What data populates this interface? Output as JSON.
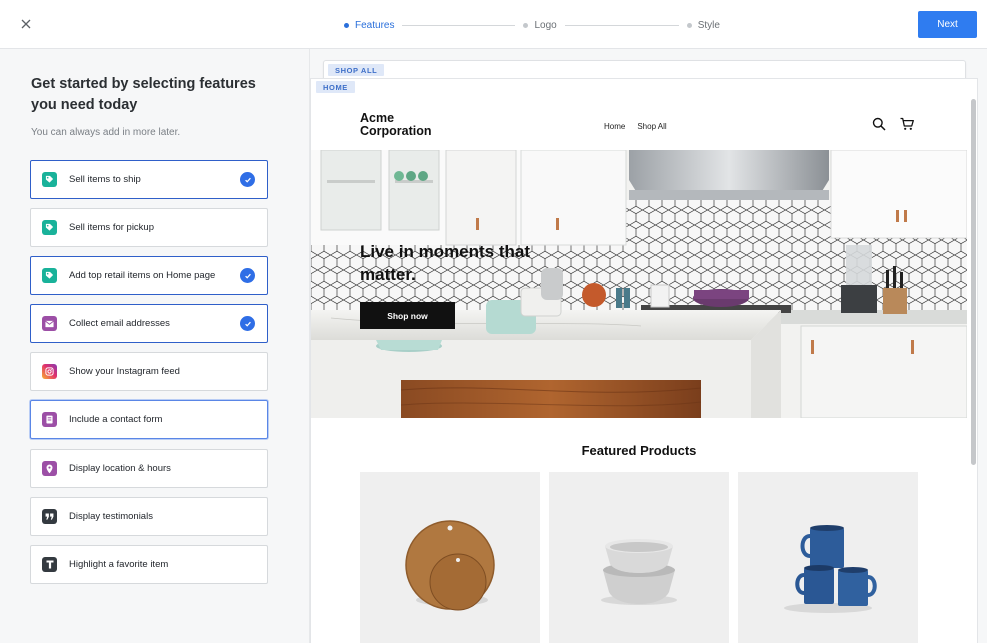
{
  "topbar": {
    "steps": [
      {
        "label": "Features",
        "active": true
      },
      {
        "label": "Logo",
        "active": false
      },
      {
        "label": "Style",
        "active": false
      }
    ],
    "next_label": "Next"
  },
  "left": {
    "heading": "Get started by selecting features you need today",
    "subtitle": "You can always add in more later."
  },
  "features": [
    {
      "label": "Sell items to ship",
      "icon": "tag-icon",
      "color": "#19b29a",
      "selected": true
    },
    {
      "label": "Sell items for pickup",
      "icon": "tag-icon",
      "color": "#19b29a",
      "selected": false
    },
    {
      "label": "Add top retail items on Home page",
      "icon": "tag-icon",
      "color": "#19b29a",
      "selected": true
    },
    {
      "label": "Collect email addresses",
      "icon": "envelope-icon",
      "color": "#9c4fa6",
      "selected": true
    },
    {
      "label": "Show your Instagram feed",
      "icon": "instagram-icon",
      "color": "#e1306c",
      "selected": false
    },
    {
      "label": "Include a contact form",
      "icon": "form-icon",
      "color": "#9c4fa6",
      "selected": false
    },
    {
      "label": "Display location & hours",
      "icon": "location-pin-icon",
      "color": "#9c4fa6",
      "selected": false
    },
    {
      "label": "Display testimonials",
      "icon": "quote-icon",
      "color": "#343a40",
      "selected": false
    },
    {
      "label": "Highlight a favorite item",
      "icon": "text-t-icon",
      "color": "#343a40",
      "selected": false
    }
  ],
  "preview": {
    "tag_back": "SHOP ALL",
    "tag_front": "HOME",
    "brand": "Acme Corporation",
    "nav": [
      "Home",
      "Shop All"
    ],
    "hero_title": "Live in moments that matter.",
    "hero_button": "Shop now",
    "featured_title": "Featured Products"
  },
  "colors": {
    "accent": "#2f7cf0",
    "selected_border": "#2f5fc9"
  }
}
